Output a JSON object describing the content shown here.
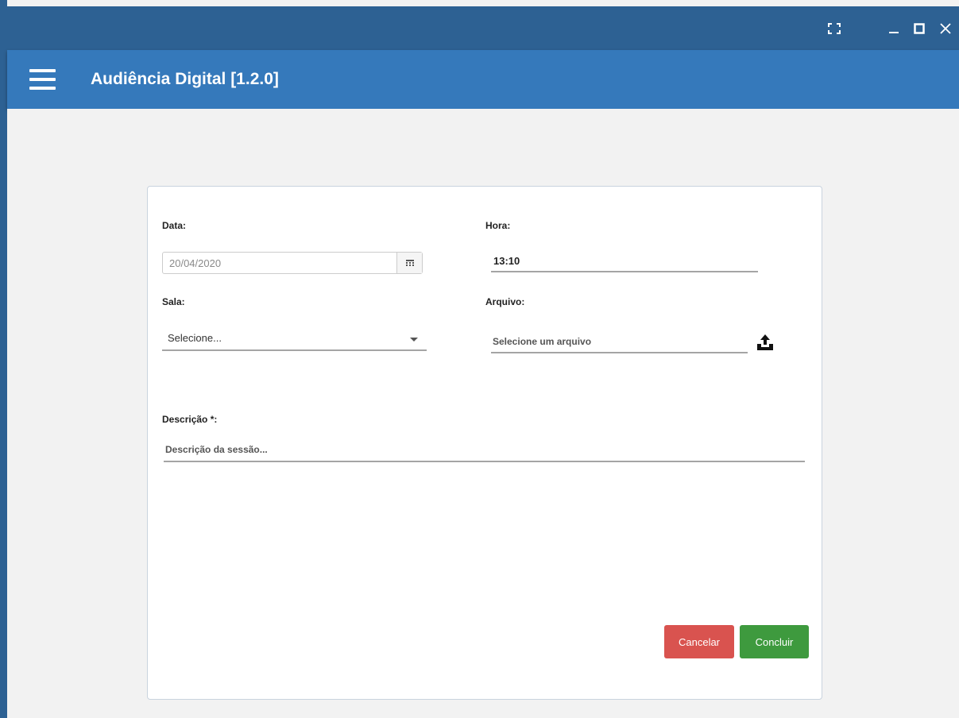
{
  "window": {
    "fullscreen_icon": "fullscreen-icon",
    "minimize_icon": "minimize-icon",
    "maximize_icon": "maximize-icon",
    "close_icon": "close-icon"
  },
  "appbar": {
    "menu_icon": "hamburger-menu-icon",
    "title": "Audiência Digital [1.2.0]"
  },
  "form": {
    "data_label": "Data:",
    "data_value": "20/04/2020",
    "hora_label": "Hora:",
    "hora_value": "13:10",
    "sala_label": "Sala:",
    "sala_value": "Selecione...",
    "arquivo_label": "Arquivo:",
    "arquivo_placeholder": "Selecione um arquivo",
    "descricao_label": "Descrição *:",
    "descricao_placeholder": "Descrição da sessão...",
    "cancel_label": "Cancelar",
    "submit_label": "Concluir"
  },
  "colors": {
    "titlebar": "#2d6193",
    "appbar": "#3579bb",
    "cancel": "#d9534f",
    "submit": "#3e9a3e"
  }
}
